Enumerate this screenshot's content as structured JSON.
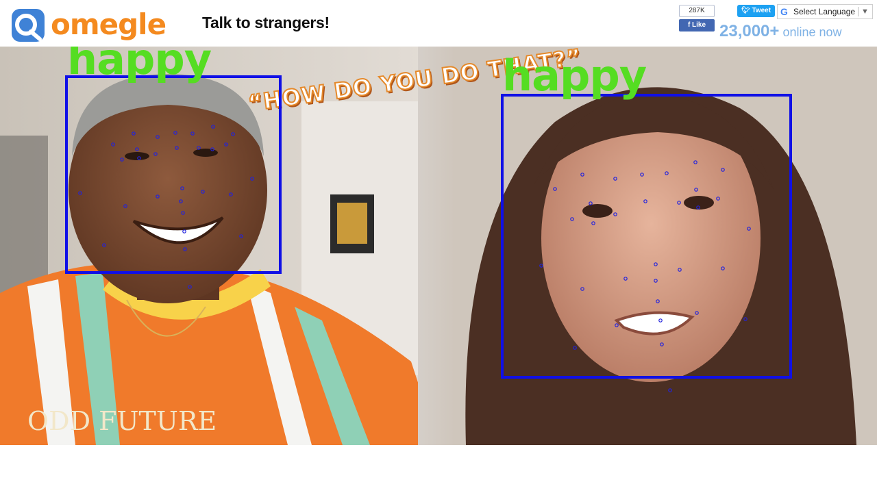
{
  "header": {
    "logo_text": "omegle",
    "tagline": "Talk to strangers!",
    "fb_like": {
      "count": "287K",
      "label": "Like"
    },
    "tweet_label": "Tweet",
    "language_select": {
      "value": "Select Language"
    },
    "online": {
      "count": "23,000+",
      "label": "online now"
    }
  },
  "video": {
    "overlay_caption": "“HOW DO YOU DO THAT?”",
    "faces": [
      {
        "emotion": "happy",
        "box_color": "#1010e6"
      },
      {
        "emotion": "happy",
        "box_color": "#1010e6"
      }
    ],
    "shirt_text": "ODD FUTURE"
  },
  "colors": {
    "brand_orange": "#f48a1f",
    "brand_blue": "#4a90d9",
    "emotion_green": "#55dd22",
    "box_blue": "#1010e6",
    "online_blue": "#7fb2e5"
  }
}
